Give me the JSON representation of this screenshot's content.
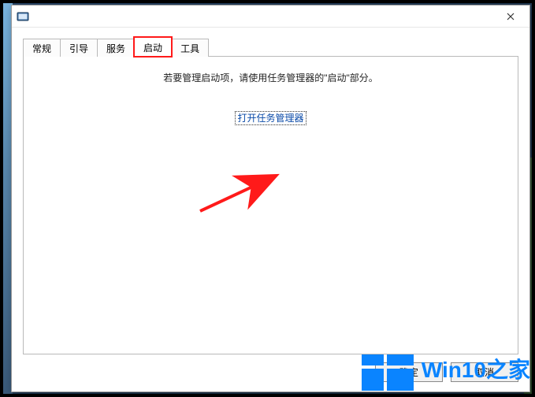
{
  "titlebar": {
    "close_aria": "Close"
  },
  "tabs": [
    {
      "id": "general",
      "label": "常规"
    },
    {
      "id": "boot",
      "label": "引导"
    },
    {
      "id": "services",
      "label": "服务"
    },
    {
      "id": "startup",
      "label": "启动"
    },
    {
      "id": "tools",
      "label": "工具"
    }
  ],
  "active_tab": "startup",
  "highlighted_tab": "startup",
  "panel": {
    "message": "若要管理启动项，请使用任务管理器的\"启动\"部分。",
    "link_label": "打开任务管理器"
  },
  "footer": {
    "ok_label": "确定",
    "cancel_label": "取消"
  },
  "watermark": {
    "text": "Win10之家"
  },
  "colors": {
    "highlight": "#ff1a1a",
    "link": "#0a4aa8",
    "accent": "#0a84ff"
  }
}
